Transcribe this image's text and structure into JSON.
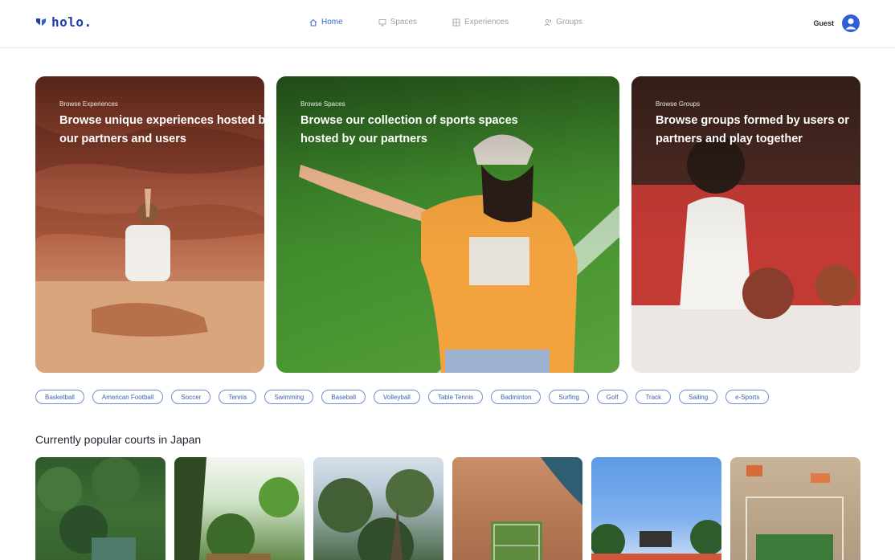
{
  "brand": {
    "name": "holo."
  },
  "nav": [
    {
      "label": "Home",
      "icon": "home-icon",
      "active": true
    },
    {
      "label": "Spaces",
      "icon": "monitor-icon",
      "active": false
    },
    {
      "label": "Experiences",
      "icon": "gallery-icon",
      "active": false
    },
    {
      "label": "Groups",
      "icon": "users-icon",
      "active": false
    }
  ],
  "user": {
    "label": "Guest",
    "icon": "user-avatar-icon"
  },
  "hero": {
    "experiences": {
      "kicker": "Browse Experiences",
      "title": "Browse unique experiences hosted by our partners and users"
    },
    "spaces": {
      "kicker": "Browse Spaces",
      "title": "Browse our collection of sports spaces hosted by our partners"
    },
    "groups": {
      "kicker": "Browse Groups",
      "title": "Browse groups formed by users or partners and play together"
    }
  },
  "sports": [
    "Basketball",
    "American Football",
    "Soccer",
    "Tennis",
    "Swimming",
    "Baseball",
    "Volleyball",
    "Table Tennis",
    "Badminton",
    "Surfing",
    "Golf",
    "Track",
    "Sailing",
    "e-Sports"
  ],
  "popular": {
    "title": "Currently popular courts in Japan"
  },
  "colors": {
    "accent": "#3568c8",
    "brand": "#1f3fa8",
    "chip_border": "#6b8fd0",
    "avatar": "#2f5ed6"
  }
}
